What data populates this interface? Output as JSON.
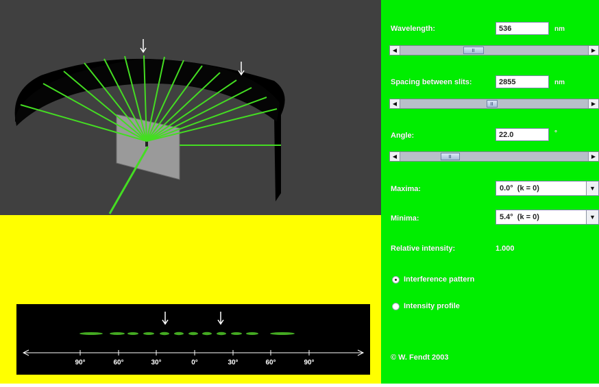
{
  "colors": {
    "panel_bg": "#00ee00",
    "scene_bg": "#404040",
    "lower_bg": "#ffff00",
    "beam": "#44dd22"
  },
  "controls": {
    "wavelength": {
      "label": "Wavelength:",
      "value": "536",
      "unit": "nm",
      "slider_position": 0.38
    },
    "spacing": {
      "label": "Spacing between slits:",
      "value": "2855",
      "unit": "nm",
      "slider_position": 0.49
    },
    "angle": {
      "label": "Angle:",
      "value": "22.0",
      "unit": "°",
      "slider_position": 0.24
    },
    "maxima": {
      "label": "Maxima:",
      "selected": "0.0°  (k = 0)"
    },
    "minima": {
      "label": "Minima:",
      "selected": "5.4°  (k = 0)"
    },
    "relative_intensity": {
      "label": "Relative intensity:",
      "value": "1.000"
    },
    "radio_interference": {
      "label": "Interference pattern",
      "selected": true
    },
    "radio_intensity": {
      "label": "Intensity profile",
      "selected": false
    },
    "copyright": "© W. Fendt 2003"
  },
  "scale": {
    "tick_labels": [
      "90°",
      "60°",
      "30°",
      "0°",
      "30°",
      "60°",
      "90°"
    ]
  },
  "icons": {
    "scroll_left": "◀",
    "scroll_right": "▶",
    "dropdown": "▼"
  }
}
